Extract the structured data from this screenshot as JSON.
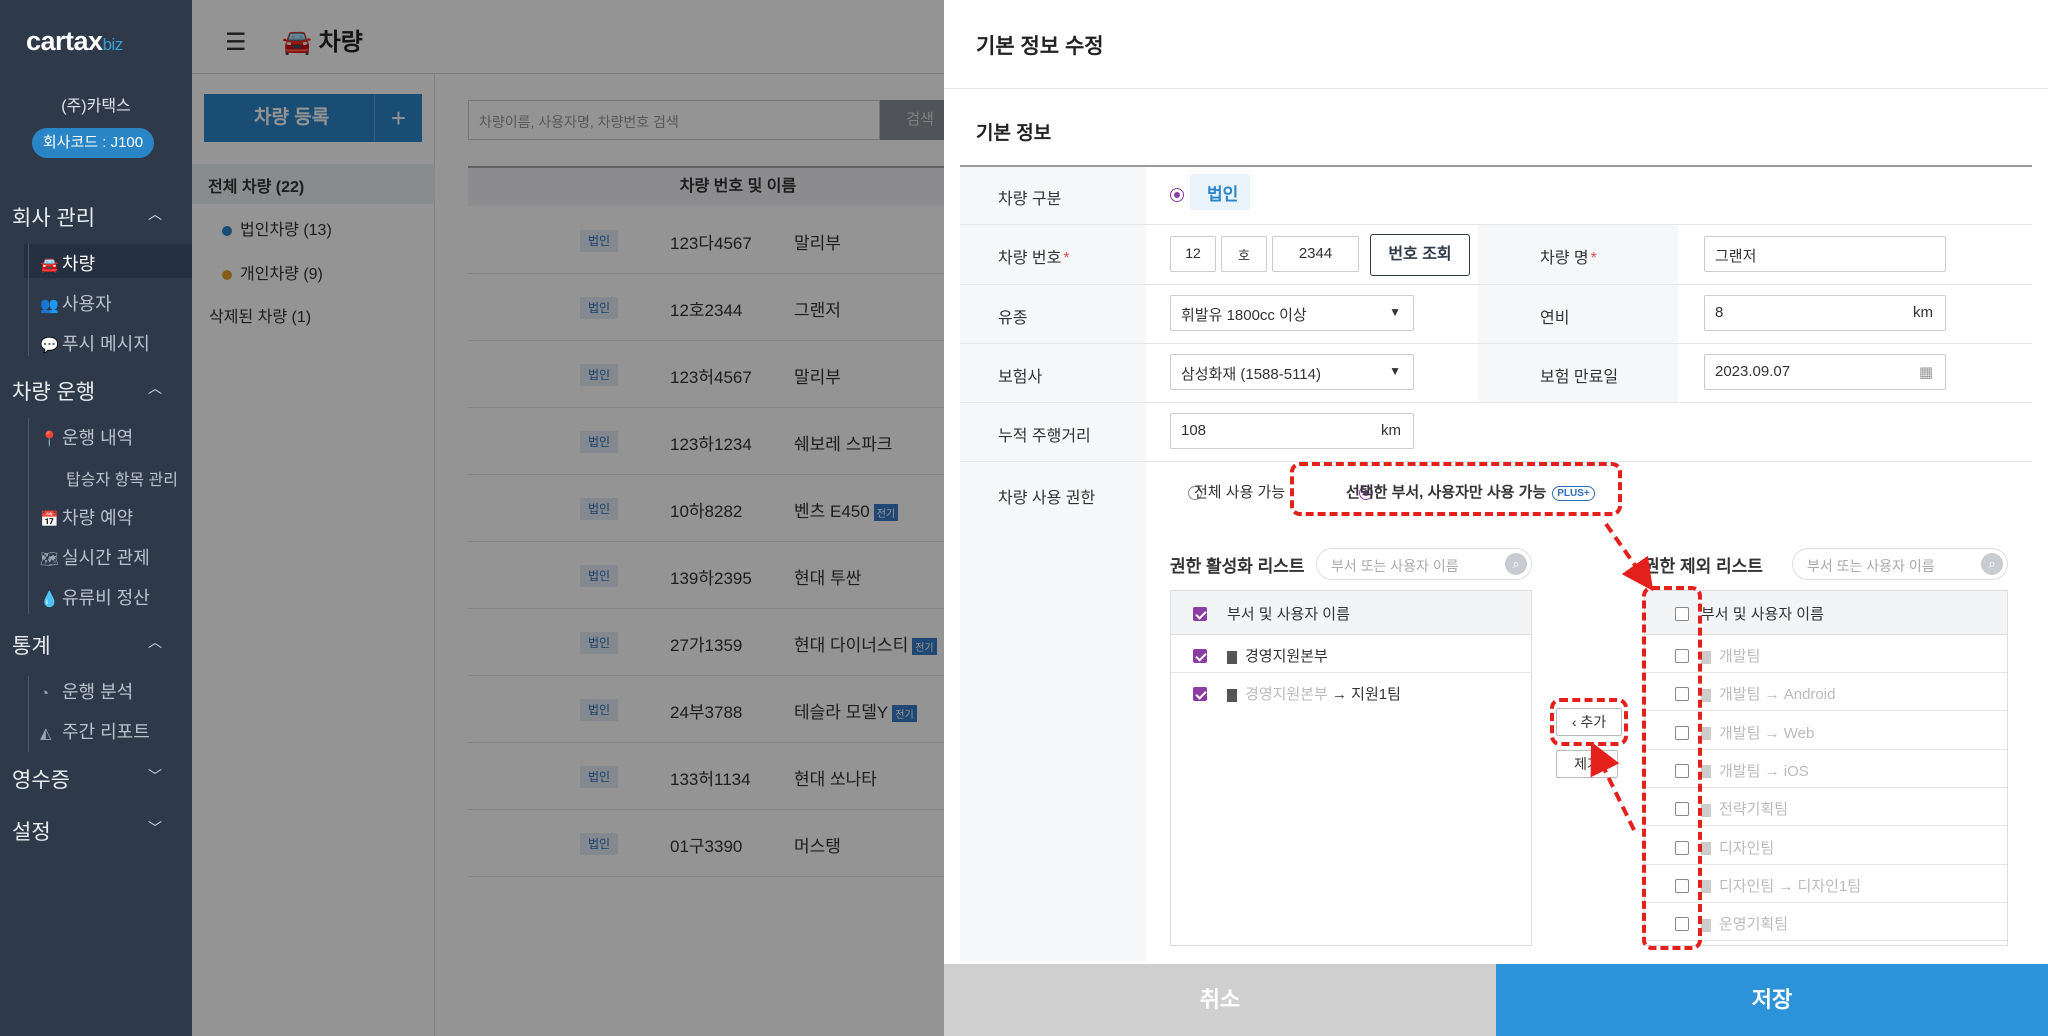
{
  "sidebar": {
    "logo_main": "cartax",
    "logo_sub": "biz",
    "company": "(주)카택스",
    "company_code": "회사코드 : J100",
    "sections": [
      {
        "label": "회사 관리",
        "items": [
          {
            "label": "차량"
          },
          {
            "label": "사용자"
          },
          {
            "label": "푸시 메시지"
          }
        ]
      },
      {
        "label": "차량 운행",
        "items": [
          {
            "label": "운행 내역"
          },
          {
            "label": "탑승자 항목 관리"
          },
          {
            "label": "차량 예약"
          },
          {
            "label": "실시간 관제"
          },
          {
            "label": "유류비 정산"
          }
        ]
      },
      {
        "label": "통계",
        "items": [
          {
            "label": "운행 분석"
          },
          {
            "label": "주간 리포트"
          }
        ]
      },
      {
        "label": "영수증",
        "items": []
      },
      {
        "label": "설정",
        "items": []
      }
    ]
  },
  "topbar": {
    "title": "차량"
  },
  "filter": {
    "register_label": "차량 등록",
    "register_plus": "+",
    "all": "전체 차량 (22)",
    "corp": "법인차량 (13)",
    "personal": "개인차량 (9)",
    "deleted": "삭제된 차량 (1)",
    "colors": {
      "corp": "#2d85c8",
      "personal": "#e3a32b"
    }
  },
  "list": {
    "search_placeholder": "차량이름, 사용자명, 차량번호 검색",
    "search_button": "검색",
    "column_header": "차량 번호 및 이름",
    "ev_badge": "전기",
    "rows": [
      {
        "tag": "법인",
        "plate": "123다4567",
        "name": "말리부",
        "ev": false
      },
      {
        "tag": "법인",
        "plate": "12호2344",
        "name": "그랜저",
        "ev": false
      },
      {
        "tag": "법인",
        "plate": "123허4567",
        "name": "말리부",
        "ev": false
      },
      {
        "tag": "법인",
        "plate": "123하1234",
        "name": "쉐보레 스파크",
        "ev": false
      },
      {
        "tag": "법인",
        "plate": "10하8282",
        "name": "벤츠 E450",
        "ev": true
      },
      {
        "tag": "법인",
        "plate": "139하2395",
        "name": "현대 투싼",
        "ev": false
      },
      {
        "tag": "법인",
        "plate": "27가1359",
        "name": "현대 다이너스티",
        "ev": true
      },
      {
        "tag": "법인",
        "plate": "24부3788",
        "name": "테슬라 모델Y",
        "ev": true
      },
      {
        "tag": "법인",
        "plate": "133허1134",
        "name": "현대 쏘나타",
        "ev": false
      },
      {
        "tag": "법인",
        "plate": "01구3390",
        "name": "머스탱",
        "ev": false
      }
    ]
  },
  "modal": {
    "title": "기본 정보 수정",
    "section_title": "기본 정보",
    "vehicle_type": {
      "label": "차량 구분",
      "value": "법인"
    },
    "plate": {
      "label": "차량 번호",
      "part1": "12",
      "part2": "호",
      "part3": "2344",
      "lookup": "번호 조회"
    },
    "vehicle_name": {
      "label": "차량 명",
      "value": "그랜저"
    },
    "fuel": {
      "label": "유종",
      "value": "휘발유 1800cc 이상"
    },
    "efficiency": {
      "label": "연비",
      "value": "8",
      "unit": "km"
    },
    "insurer": {
      "label": "보험사",
      "value": "삼성화재 (1588-5114)"
    },
    "insurance_expiry": {
      "label": "보험 만료일",
      "value": "2023.09.07"
    },
    "mileage": {
      "label": "누적 주행거리",
      "value": "108",
      "unit": "km"
    },
    "permission": {
      "label": "차량 사용 권한",
      "option_all": "전체 사용 가능",
      "option_selected": "선택한 부서, 사용자만 사용 가능",
      "plus_badge": "PLUS+"
    },
    "active_list": {
      "title": "권한 활성화 리스트",
      "search_placeholder": "부서 또는 사용자 이름",
      "header": "부서 및 사용자 이름",
      "items": [
        {
          "prefix": "",
          "name": "경영지원본부"
        },
        {
          "prefix": "경영지원본부",
          "name": "지원1팀"
        }
      ]
    },
    "exclude_list": {
      "title": "권한 제외 리스트",
      "search_placeholder": "부서 또는 사용자 이름",
      "header": "부서 및 사용자 이름",
      "items": [
        "개발팀",
        "개발팀 → Android",
        "개발팀 → Web",
        "개발팀 → iOS",
        "전략기획팀",
        "디자인팀",
        "디자인팀 → 디자인1팀",
        "운영기획팀"
      ]
    },
    "add_button": "‹ 추가",
    "remove_button": "제거",
    "arrow_sep": "→",
    "cancel": "취소",
    "save": "저장"
  },
  "colors": {
    "accent": "#2d85c8",
    "save": "#2d93d8",
    "checkbox": "#8a3ea2",
    "sidebar": "#2e3a49",
    "annotation": "#e3201b"
  }
}
